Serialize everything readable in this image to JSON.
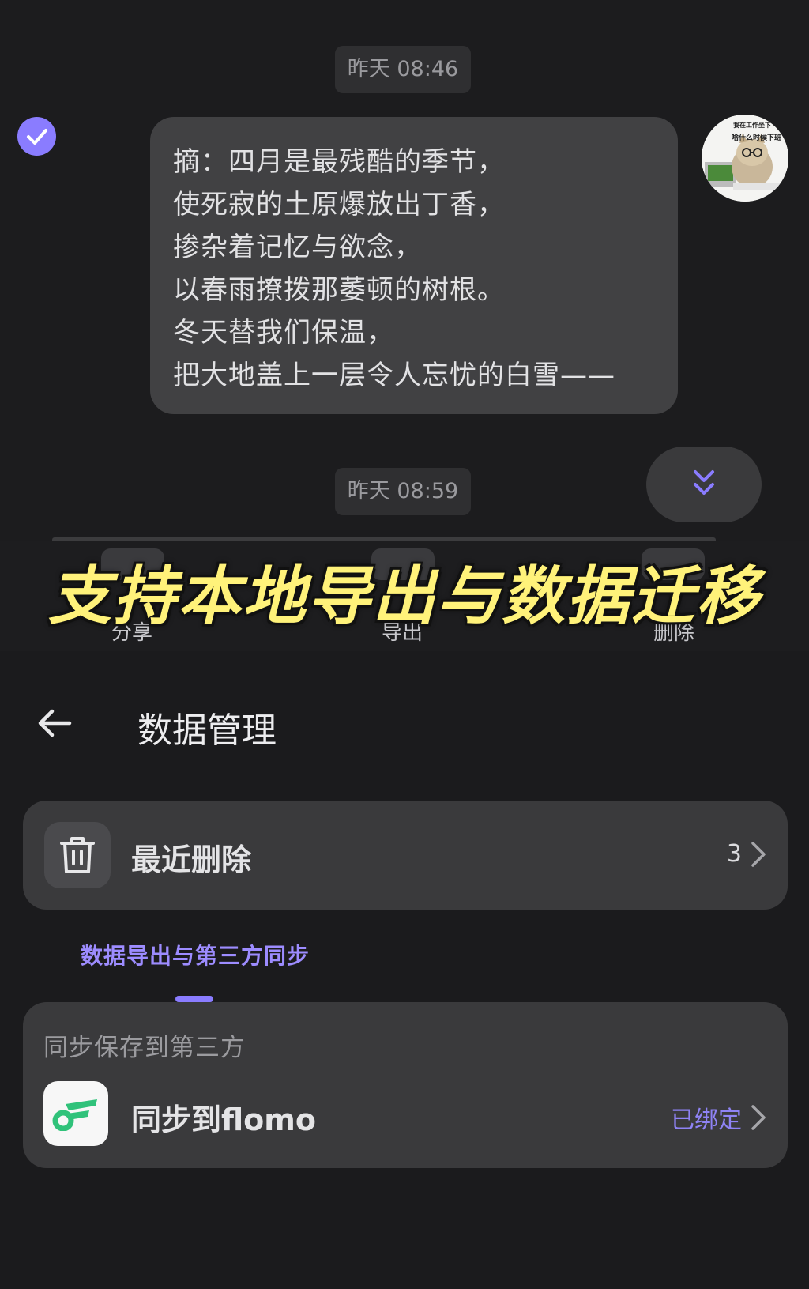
{
  "chat": {
    "timestamps": [
      "昨天 08:46",
      "昨天 08:59"
    ],
    "message_lines": [
      "摘：四月是最残酷的季节，",
      "使死寂的土原爆放出丁香，",
      "掺杂着记忆与欲念，",
      "以春雨撩拨那萎顿的树根。",
      "冬天替我们保温，",
      "把大地盖上一层令人忘忧的白雪——"
    ],
    "avatar_caption_top": "我在工作坐下",
    "avatar_caption": "啥什么时候下班"
  },
  "actions": {
    "share": "分享",
    "export": "导出",
    "delete": "删除"
  },
  "overlay_title": "支持本地导出与数据迁移",
  "page": {
    "title": "数据管理",
    "recently_deleted": {
      "label": "最近删除",
      "count": "3"
    },
    "tab": "数据导出与第三方同步",
    "sync_section": {
      "heading": "同步保存到第三方",
      "item_label": "同步到flomo",
      "status": "已绑定"
    }
  },
  "colors": {
    "accent": "#8a7cff",
    "title_yellow": "#fff27a",
    "flomo_green": "#30c27a",
    "background": "#1b1b1d"
  }
}
